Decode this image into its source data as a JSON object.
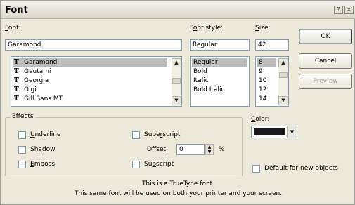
{
  "window": {
    "title": "Font",
    "help_button": "?",
    "close_button": "×"
  },
  "font": {
    "label": "Font:",
    "mnemonic": "F",
    "label_rest": "ont:",
    "value": "Garamond",
    "items": [
      "Garamond",
      "Gautami",
      "Georgia",
      "Gigi",
      "Gill Sans MT"
    ],
    "selected_index": 0,
    "item_icon": "truetype-icon"
  },
  "style": {
    "label_pre": "F",
    "mnemonic": "o",
    "label_post": "nt style:",
    "value": "Regular",
    "items": [
      "Regular",
      "Bold",
      "Italic",
      "Bold Italic"
    ],
    "selected_index": 0
  },
  "size": {
    "mnemonic": "S",
    "label_post": "ize:",
    "value": "42",
    "items": [
      "8",
      "9",
      "10",
      "12",
      "14"
    ],
    "selected_index": 0
  },
  "buttons": {
    "ok": "OK",
    "cancel": "Cancel",
    "preview_pre": "",
    "preview_mnemonic": "P",
    "preview_post": "review"
  },
  "effects": {
    "legend": "Effects",
    "underline_mn": "U",
    "underline_rest": "nderline",
    "shadow_pre": "Sh",
    "shadow_mn": "a",
    "shadow_post": "dow",
    "emboss_mn": "E",
    "emboss_rest": "mboss",
    "superscript_pre": "Supe",
    "superscript_mn": "r",
    "superscript_post": "script",
    "offset_pre": "Offse",
    "offset_mn": "t",
    "offset_post": ":",
    "offset_value": "0",
    "offset_unit": "%",
    "subscript_pre": "Su",
    "subscript_mn": "b",
    "subscript_post": "script"
  },
  "color": {
    "mnemonic": "C",
    "label_post": "olor:",
    "value_hex": "#1a1a1a"
  },
  "default_new": {
    "mnemonic": "D",
    "label_post": "efault for new objects"
  },
  "description": {
    "line1": "This is a TrueType font.",
    "line2": "This same font will be used on both your printer and your screen."
  }
}
